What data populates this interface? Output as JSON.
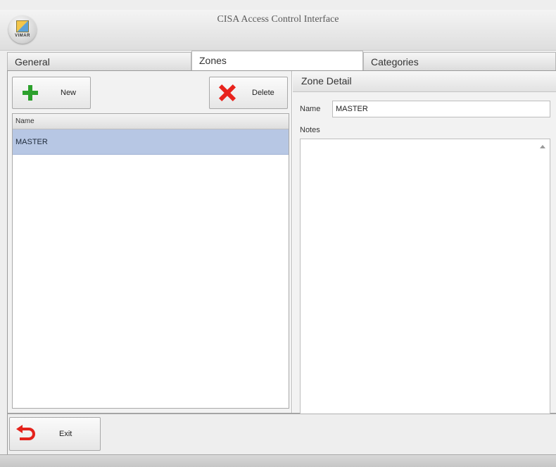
{
  "window": {
    "title": "CISA Access Control Interface",
    "logo_text": "VIMAR"
  },
  "tabs": [
    {
      "label": "General",
      "active": false
    },
    {
      "label": "Zones",
      "active": true
    },
    {
      "label": "Categories",
      "active": false
    }
  ],
  "toolbar": {
    "new_label": "New",
    "delete_label": "Delete"
  },
  "zones_list": {
    "column_header": "Name",
    "rows": [
      {
        "name": "MASTER",
        "selected": true
      }
    ]
  },
  "zone_detail": {
    "header": "Zone Detail",
    "name_label": "Name",
    "name_value": "MASTER",
    "notes_label": "Notes",
    "notes_value": ""
  },
  "footer": {
    "exit_label": "Exit"
  },
  "icons": {
    "new": "plus-icon",
    "delete": "delete-x-icon",
    "exit": "exit-arrow-icon",
    "logo": "vimar-logo-icon"
  },
  "colors": {
    "new_icon": "#2ca02c",
    "delete_icon": "#e8231c",
    "exit_icon": "#e4221b",
    "selected_row": "#b7c7e4"
  }
}
